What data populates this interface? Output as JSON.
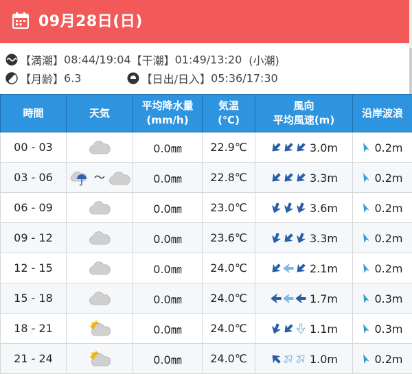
{
  "header": {
    "date": "09月28日(日)"
  },
  "tide": {
    "high_label": "【満潮】",
    "high_times": "08:44/19:04",
    "low_label": "【干潮】",
    "low_times": "01:49/13:20",
    "tide_type": "(小潮)"
  },
  "moon": {
    "label": "【月齢】",
    "value": "6.3"
  },
  "sun": {
    "label": "【日出/日入】",
    "value": "05:36/17:30"
  },
  "table": {
    "headers": {
      "time": "時間",
      "weather": "天気",
      "rain_line1": "平均降水量",
      "rain_line2": "(mm/h)",
      "temp_line1": "気温",
      "temp_line2": "(℃)",
      "wind_line1": "風向",
      "wind_line2": "平均風速(m)",
      "wave": "沿岸波浪"
    },
    "rows": [
      {
        "time": "00 - 03",
        "weather": "cloudy",
        "rain": "0.0㎜",
        "temp": "22.9℃",
        "wind_dirs": [
          "sw",
          "sw",
          "sw"
        ],
        "wind": "3.0m",
        "wave": "0.2m"
      },
      {
        "time": "03 - 06",
        "weather": "rain-then-cloudy",
        "tilde": "～",
        "rain": "0.0㎜",
        "temp": "22.8℃",
        "wind_dirs": [
          "sw",
          "sw",
          "sw"
        ],
        "wind": "3.3m",
        "wave": "0.2m"
      },
      {
        "time": "06 - 09",
        "weather": "cloudy",
        "rain": "0.0㎜",
        "temp": "23.0℃",
        "wind_dirs": [
          "ssw",
          "ssw",
          "ssw"
        ],
        "wind": "3.6m",
        "wave": "0.2m"
      },
      {
        "time": "09 - 12",
        "weather": "cloudy",
        "rain": "0.0㎜",
        "temp": "23.6℃",
        "wind_dirs": [
          "ssw",
          "sw",
          "ssw"
        ],
        "wind": "3.3m",
        "wave": "0.2m"
      },
      {
        "time": "12 - 15",
        "weather": "cloudy",
        "rain": "0.0㎜",
        "temp": "24.0℃",
        "wind_dirs": [
          "sw",
          "w",
          "sw"
        ],
        "wind": "2.1m",
        "wave": "0.2m"
      },
      {
        "time": "15 - 18",
        "weather": "cloudy",
        "rain": "0.0㎜",
        "temp": "24.0℃",
        "wind_dirs": [
          "w",
          "w",
          "w"
        ],
        "wind": "1.7m",
        "wave": "0.3m"
      },
      {
        "time": "18 - 21",
        "weather": "partly-cloudy",
        "rain": "0.0㎜",
        "temp": "24.0℃",
        "wind_dirs": [
          "ssw",
          "sw",
          "s"
        ],
        "wind": "1.1m",
        "wave": "0.3m"
      },
      {
        "time": "21 - 24",
        "weather": "partly-cloudy",
        "rain": "0.0㎜",
        "temp": "24.0℃",
        "wind_dirs": [
          "nw",
          "ne",
          "ne"
        ],
        "wind": "1.0m",
        "wave": "0.2m"
      }
    ]
  },
  "colors": {
    "header_bg": "#f25a5a",
    "table_header_bg": "#2e94e0",
    "arrow_dark": "#2a5fa8",
    "arrow_light": "#7fb8e6",
    "wave_arrow": "#2a9fd6"
  }
}
